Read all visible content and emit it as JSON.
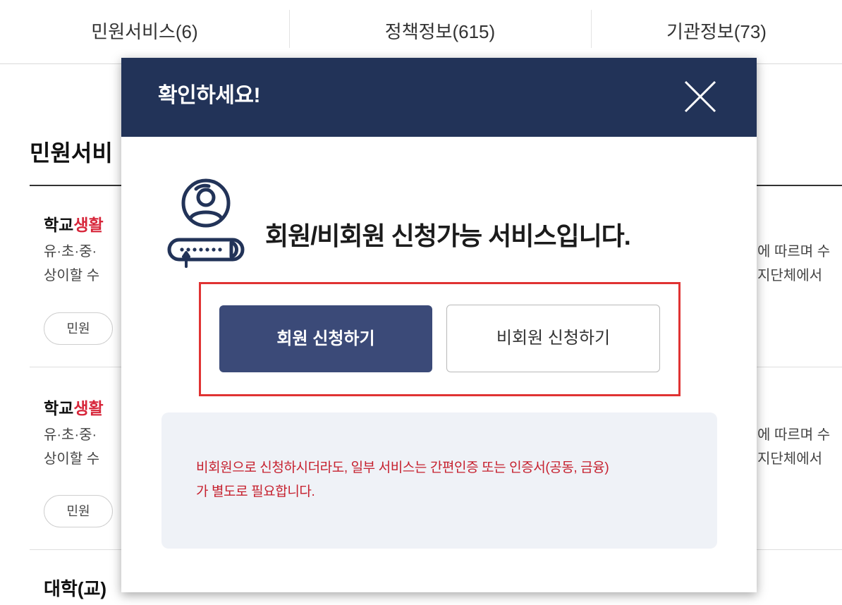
{
  "tabs": [
    {
      "label": "민원서비스(6)"
    },
    {
      "label": "정책정보(615)"
    },
    {
      "label": "기관정보(73)"
    }
  ],
  "section": {
    "title": "민원서비"
  },
  "results": [
    {
      "title_prefix": "학교",
      "title_highlight": "생활",
      "desc_left_1": "유·초·중·",
      "desc_left_2": "상이할 수",
      "desc_right_1": "에 따르며 수",
      "desc_right_2": "지단체에서",
      "tag": "민원"
    },
    {
      "title_prefix": "학교",
      "title_highlight": "생활",
      "desc_left_1": "유·초·중·",
      "desc_left_2": "상이할 수",
      "desc_right_1": "에 따르며 수",
      "desc_right_2": "지단체에서",
      "tag": "민원"
    },
    {
      "title_prefix": "대학(교)"
    }
  ],
  "modal": {
    "title": "확인하세요!",
    "close_icon": "close-icon",
    "service_icon": "member-login-icon",
    "message": "회원/비회원 신청가능 서비스입니다.",
    "member_button": "회원 신청하기",
    "guest_button": "비회원 신청하기",
    "notice_line1": "비회원으로 신청하시더라도, 일부 서비스는 간편인증 또는 인증서(공동, 금융)",
    "notice_line2": "가 별도로 필요합니다."
  },
  "colors": {
    "header_bg": "#223358",
    "member_button_bg": "#3b4a78",
    "highlight_frame": "#e03333",
    "notice_text": "#c6202e",
    "notice_bg": "#eff2f7",
    "keyword_highlight": "#d7263a"
  }
}
